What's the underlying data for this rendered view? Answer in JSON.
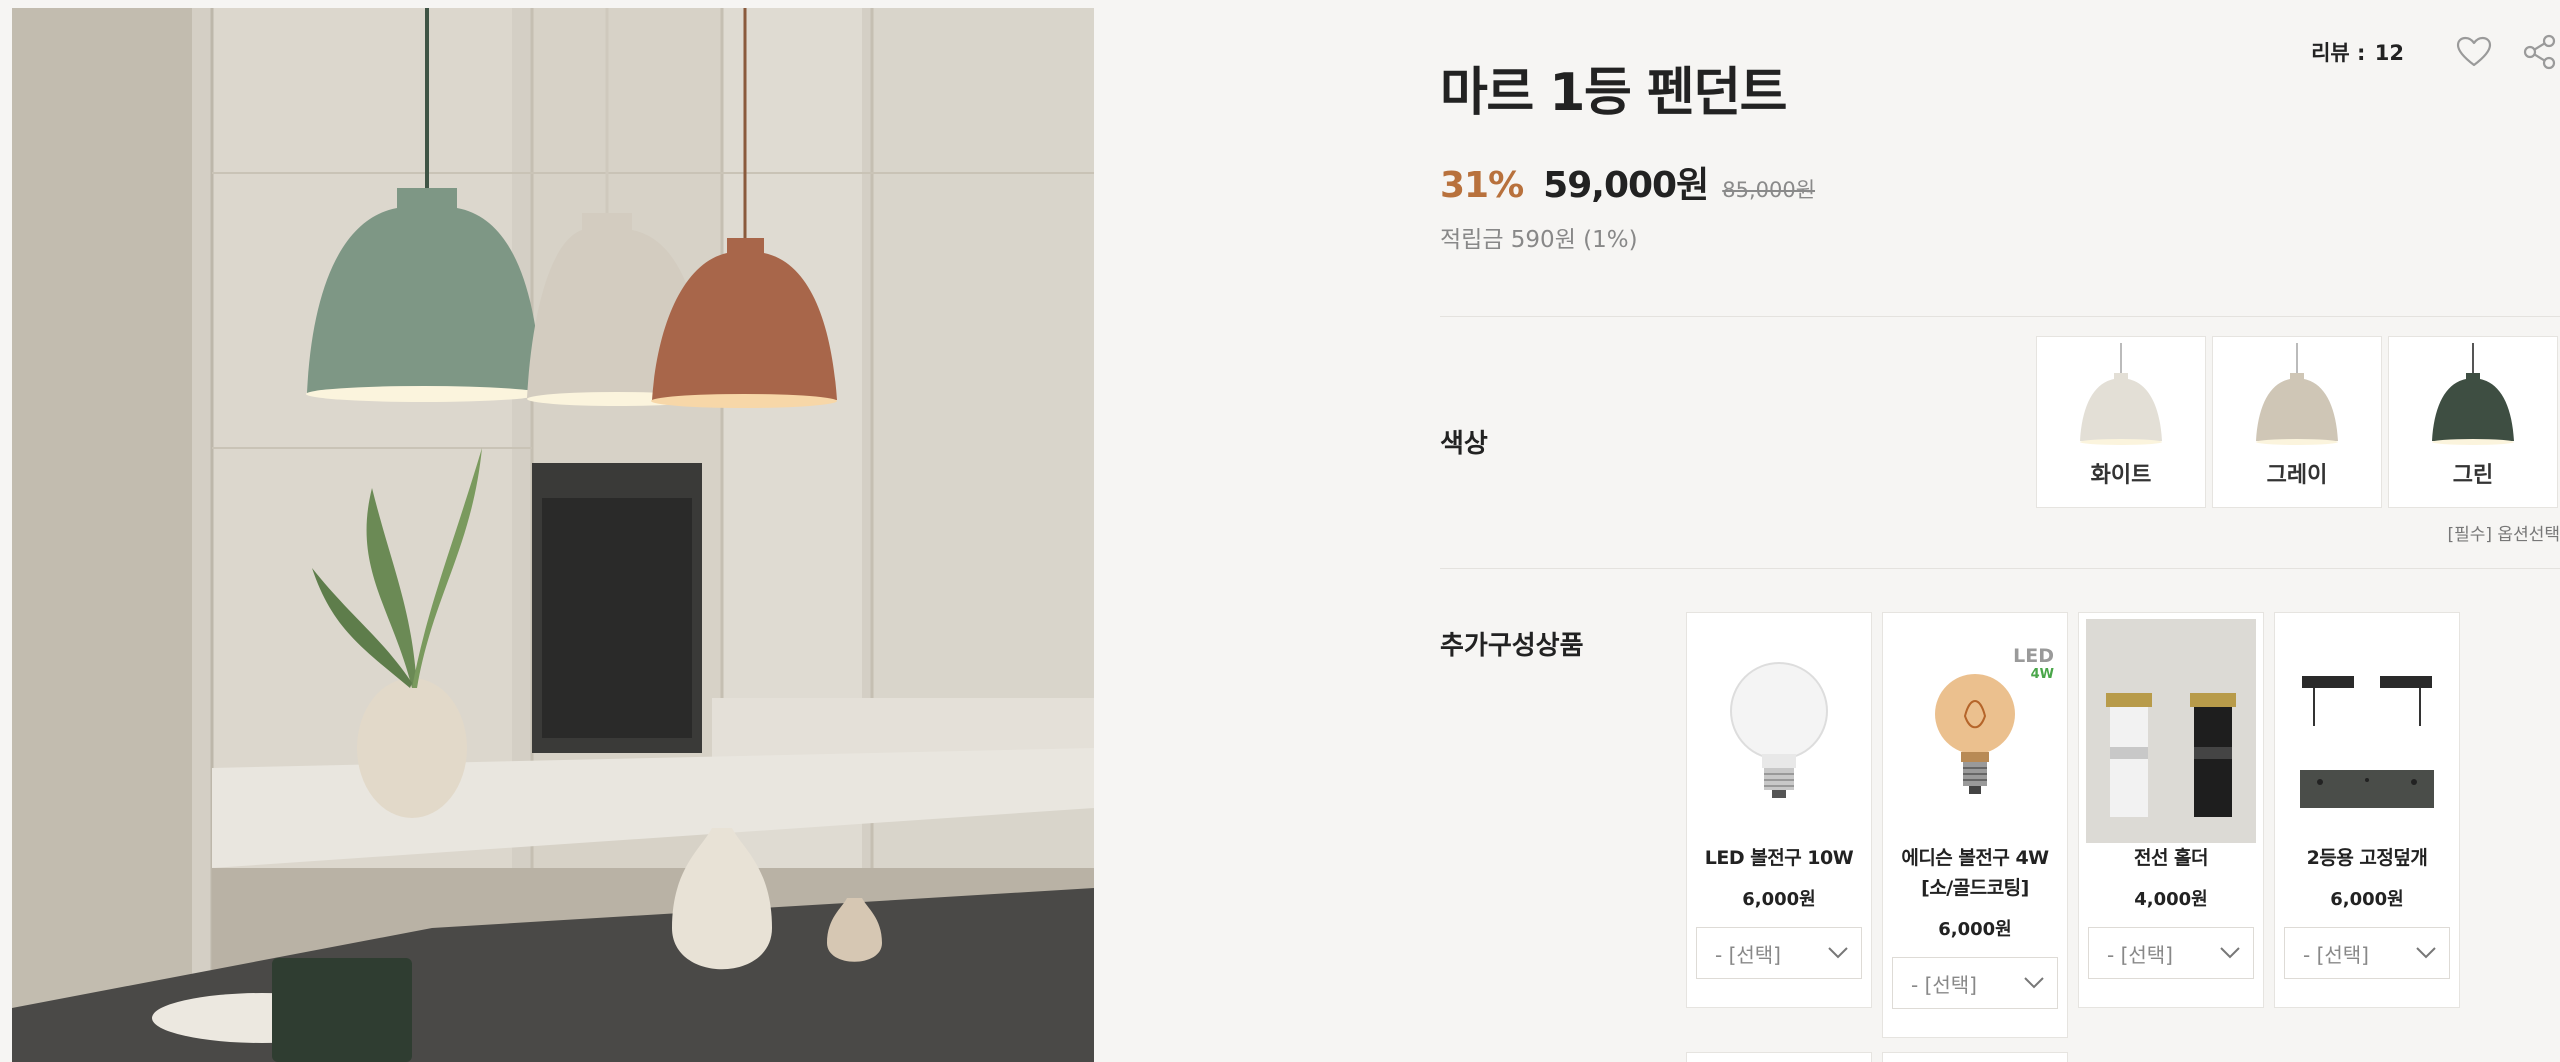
{
  "product": {
    "title": "마르 1등 펜던트",
    "review_label": "리뷰 : ",
    "review_count": "12",
    "discount": "31%",
    "sale_price": "59,000원",
    "original_price": "85,000원",
    "points": "적립금 590원 (1%)"
  },
  "options": {
    "color_label": "색상",
    "colors": [
      {
        "label": "화이트",
        "shade": "#e3dfd6"
      },
      {
        "label": "그레이",
        "shade": "#cfc6b6"
      },
      {
        "label": "그린",
        "shade": "#3e4e42"
      }
    ],
    "required_note": "[필수] 옵션선택"
  },
  "addons": {
    "label": "추가구성상품",
    "items": [
      {
        "name": "LED 볼전구 10W",
        "price": "6,000원",
        "select": "- [선택]"
      },
      {
        "name": "에디슨 볼전구 4W [소/골드코팅]",
        "price": "6,000원",
        "select": "- [선택]",
        "badge_led": "LED",
        "badge_watt": "4W"
      },
      {
        "name": "전선 홀더",
        "price": "4,000원",
        "select": "- [선택]"
      },
      {
        "name": "2등용 고정덮개",
        "price": "6,000원",
        "select": "- [선택]"
      }
    ]
  },
  "colors": {
    "accent": "#b8713c",
    "background": "#f6f5f3"
  }
}
